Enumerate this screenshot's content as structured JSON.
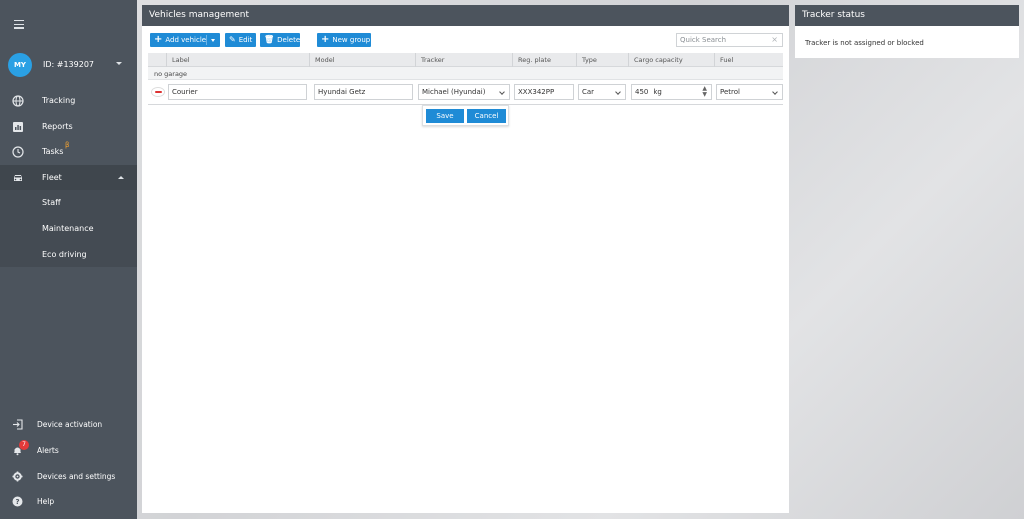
{
  "account": {
    "initials": "MY",
    "id": "ID: #139207"
  },
  "nav": {
    "tracking": "Tracking",
    "reports": "Reports",
    "tasks": "Tasks",
    "tasks_badge": "β",
    "fleet": "Fleet",
    "staff": "Staff",
    "maintenance": "Maintenance",
    "eco_driving": "Eco driving"
  },
  "bottom_nav": {
    "device_activation": "Device activation",
    "alerts": "Alerts",
    "alerts_count": "7",
    "devices_settings": "Devices and settings",
    "help": "Help"
  },
  "panel": {
    "title": "Vehicles management",
    "toolbar": {
      "add_vehicle": "Add vehicle",
      "edit": "Edit",
      "delete": "Delete",
      "new_group": "New group"
    },
    "search_placeholder": "Quick Search",
    "columns": [
      "Label",
      "Model",
      "Tracker",
      "Reg. plate",
      "Type",
      "Cargo capacity",
      "Fuel"
    ],
    "group_name": "no garage",
    "edit_row": {
      "label": "Courier",
      "model": "Hyundai Getz",
      "tracker": "Michael (Hyundai)",
      "reg_plate": "XXX342PP",
      "type": "Car",
      "cargo_capacity": "450",
      "cargo_unit": "kg",
      "fuel": "Petrol"
    },
    "save": "Save",
    "cancel": "Cancel"
  },
  "tracker_status": {
    "title": "Tracker status",
    "message": "Tracker is not assigned or blocked"
  },
  "colors": {
    "sidebar": "#4c545d",
    "accent": "#1f8bd6",
    "avatar": "#2aa0e4",
    "alert": "#e23a3a"
  }
}
